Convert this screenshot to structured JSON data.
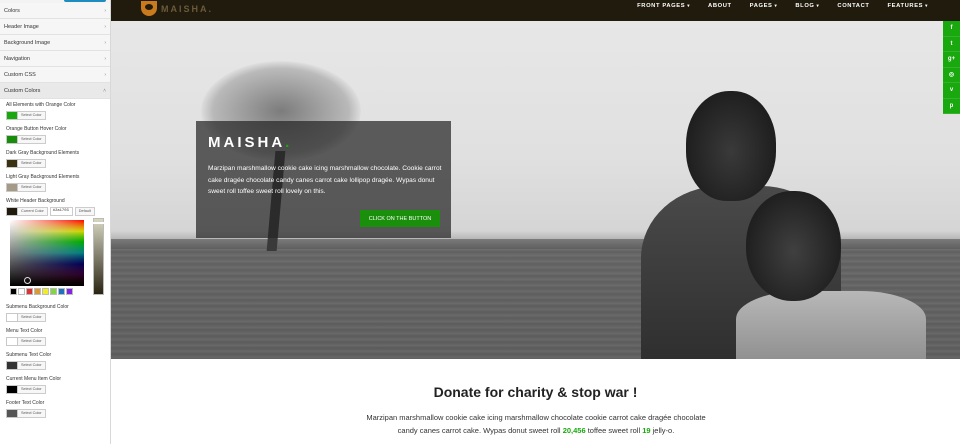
{
  "customizer": {
    "sections": [
      {
        "label": "Colors"
      },
      {
        "label": "Header Image"
      },
      {
        "label": "Background Image"
      },
      {
        "label": "Navigation"
      },
      {
        "label": "Custom CSS"
      },
      {
        "label": "Custom Colors"
      }
    ],
    "options": [
      {
        "label": "All Elements with Orange Color",
        "color": "#1aa80f",
        "button": "Select Color"
      },
      {
        "label": "Orange Button Hover Color",
        "color": "#178d0b",
        "button": "Select Color"
      },
      {
        "label": "Dark Gray Background Elements",
        "color": "#3a3110",
        "button": "Select Color"
      },
      {
        "label": "Light Gray Background Elements",
        "color": "#a59a86",
        "button": "Select Color"
      }
    ],
    "active_option": {
      "label": "White Header Background",
      "color": "#211b0d",
      "current_button": "Current Color",
      "hex_value": "#2a1703",
      "default_button": "Default"
    },
    "palette": [
      "#000000",
      "#ffffff",
      "#dd3333",
      "#dd9933",
      "#eeee22",
      "#81d742",
      "#1e73be",
      "#8224e3"
    ],
    "options_after": [
      {
        "label": "Submenu Background Color",
        "color": "#ffffff",
        "button": "Select Color"
      },
      {
        "label": "Menu Text Color",
        "color": "#ffffff",
        "button": "Select Color"
      },
      {
        "label": "Submenu Text Color",
        "color": "#333333",
        "button": "Select Color"
      },
      {
        "label": "Current Menu Item Color",
        "color": "#000000",
        "button": "Select Color"
      },
      {
        "label": "Footer Text Color",
        "color": "#555555",
        "button": "Select Color"
      }
    ]
  },
  "site": {
    "logo_text": "MAISHA",
    "logo_dot": ".",
    "nav": [
      {
        "label": "FRONT PAGES",
        "caret": "▾"
      },
      {
        "label": "ABOUT",
        "caret": ""
      },
      {
        "label": "PAGES",
        "caret": "▾"
      },
      {
        "label": "BLOG",
        "caret": "▾"
      },
      {
        "label": "CONTACT",
        "caret": ""
      },
      {
        "label": "FEATURES",
        "caret": "▾"
      }
    ],
    "hero": {
      "title": "MAISHA",
      "title_dot": ".",
      "text": "Marzipan marshmallow cookie cake icing marshmallow chocolate. Cookie carrot cake dragée chocolate candy canes carrot cake lollipop dragée. Wypas donut sweet roll toffee sweet roll lovely on this.",
      "button": "CLICK ON THE BUTTON"
    },
    "social": [
      {
        "icon": "facebook-icon",
        "glyph": "f"
      },
      {
        "icon": "twitter-icon",
        "glyph": "t"
      },
      {
        "icon": "googleplus-icon",
        "glyph": "g+"
      },
      {
        "icon": "instagram-icon",
        "glyph": "◎"
      },
      {
        "icon": "vimeo-icon",
        "glyph": "v"
      },
      {
        "icon": "pinterest-icon",
        "glyph": "p"
      }
    ],
    "content": {
      "title": "Donate for charity & stop war !",
      "text_line1": "Marzipan marshmallow cookie cake icing marshmallow chocolate cookie carrot cake dragée chocolate",
      "text_line2_a": "candy canes carrot cake. Wypas donut sweet roll ",
      "number1": "20,456",
      "text_line2_b": " toffee sweet roll ",
      "number2": "19",
      "text_line2_c": " jelly-o."
    },
    "accent_color": "#1aa80f"
  }
}
